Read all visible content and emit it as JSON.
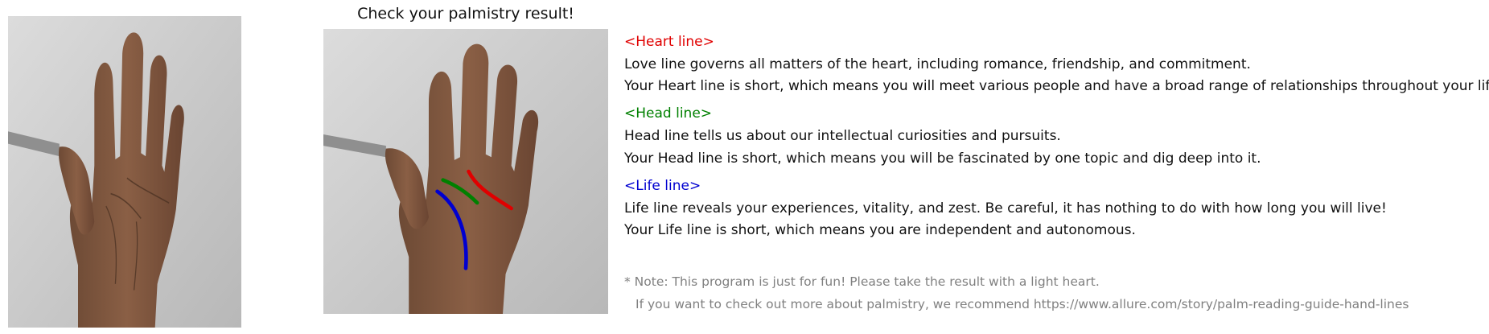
{
  "result_title": "Check your palmistry result!",
  "colors": {
    "heart": "#e00000",
    "head": "#008000",
    "life": "#0000d0",
    "note": "#808080"
  },
  "lines": [
    {
      "heading": "<Heart line>",
      "description": "Love line governs all matters of the heart, including romance, friendship, and commitment.",
      "result": "Your Heart line is short, which means you will meet various people and have a broad range of relationships throughout your life."
    },
    {
      "heading": "<Head line>",
      "description": "Head line tells us about our intellectual curiosities and pursuits.",
      "result": "Your Head line is short, which means you will be fascinated by one topic and dig deep into it."
    },
    {
      "heading": "<Life line>",
      "description": "Life line reveals your experiences, vitality, and zest. Be careful, it has nothing to do with how long you will live!",
      "result": "Your Life line is short, which means you are independent and autonomous."
    }
  ],
  "note": {
    "line1": "* Note: This program is just for fun! Please take the result with a light heart.",
    "line2": "If you want to check out more about palmistry, we recommend https://www.allure.com/story/palm-reading-guide-hand-lines"
  }
}
